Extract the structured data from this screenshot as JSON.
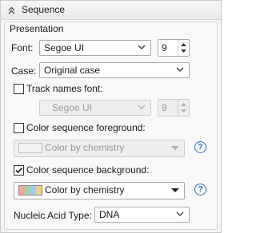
{
  "panel": {
    "title": "Sequence",
    "group_title": "Presentation"
  },
  "font": {
    "label": "Font:",
    "value": "Segoe UI",
    "size": "9"
  },
  "case": {
    "label": "Case:",
    "value": "Original case"
  },
  "track_names_font": {
    "label": "Track names font:",
    "checked": false,
    "value": "Segoe UI",
    "size": "9"
  },
  "color_foreground": {
    "label": "Color sequence foreground:",
    "checked": false,
    "value": "Color by chemistry",
    "help": "?"
  },
  "color_background": {
    "label": "Color sequence background:",
    "checked": true,
    "value": "Color by chemistry",
    "help": "?",
    "swatch_colors": [
      "#f4a6a0",
      "#9fd6a0",
      "#a7c8f0",
      "#f3d37e"
    ]
  },
  "nucleic_acid": {
    "label": "Nucleic Acid Type:",
    "value": "DNA"
  },
  "icons": {
    "collapse": "collapse-up-icon",
    "dropdown": "chevron-down-icon",
    "spin_up": "spin-up-icon",
    "spin_down": "spin-down-icon",
    "help": "help-circle-icon",
    "check": "check-icon"
  },
  "colors": {
    "accent": "#2e6fbd",
    "disabled_text": "#9a9a9a"
  }
}
